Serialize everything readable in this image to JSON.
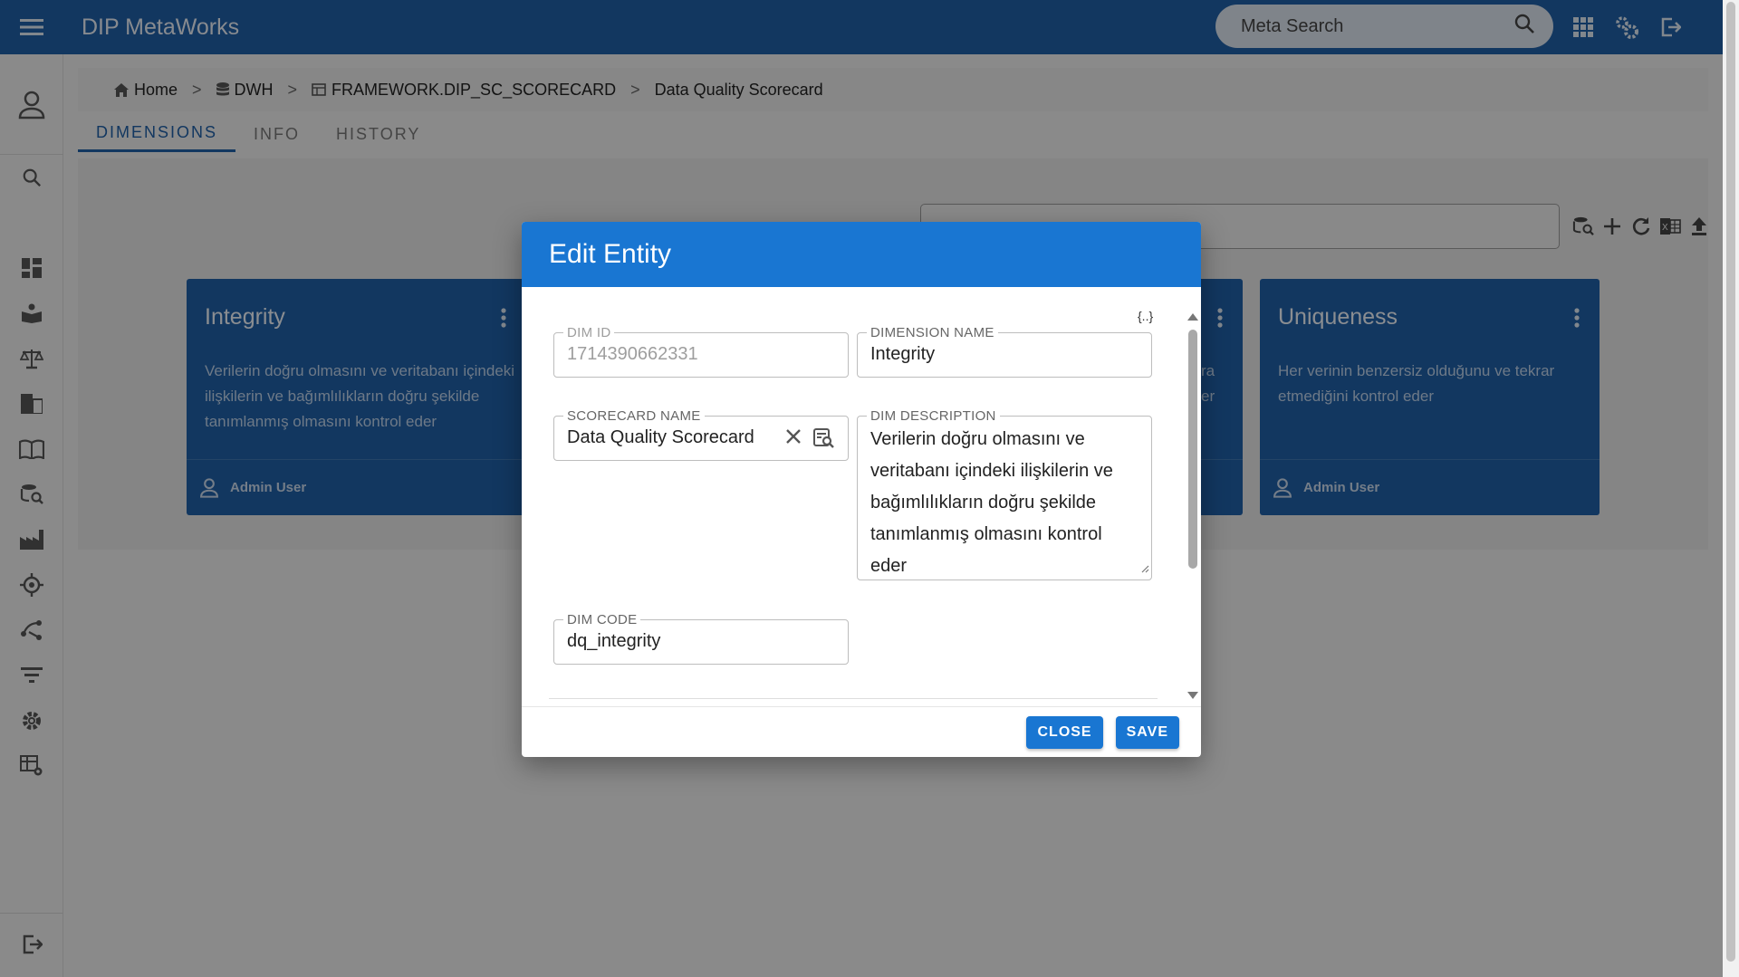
{
  "app": {
    "title": "DIP MetaWorks"
  },
  "header": {
    "search_placeholder": "Meta Search"
  },
  "breadcrumb": [
    {
      "label": "Home",
      "icon": "home-icon"
    },
    {
      "label": "DWH",
      "icon": "database-icon"
    },
    {
      "label": "FRAMEWORK.DIP_SC_SCORECARD",
      "icon": "table-icon"
    },
    {
      "label": "Data Quality Scorecard"
    }
  ],
  "breadcrumb_separator": ">",
  "tabs": [
    {
      "label": "DIMENSIONS",
      "active": true
    },
    {
      "label": "INFO"
    },
    {
      "label": "HISTORY"
    }
  ],
  "cards": [
    {
      "title": "Integrity",
      "description": "Verilerin doğru olmasını ve veritabanı içindeki ilişkilerin ve bağımlılıkların doğru şekilde tanımlanmış olmasını kontrol eder",
      "user": "Admin User"
    },
    {
      "title": "Uniqueness",
      "description": "Her verinin benzersiz olduğunu ve tekrar etmediğini kontrol eder",
      "user": "Admin User"
    }
  ],
  "partial_card": {
    "text_line1": "ra",
    "text_line2": "er"
  },
  "dialog": {
    "title": "Edit Entity",
    "json_toggle": "{..}",
    "fields": {
      "dim_id": {
        "label": "DIM ID",
        "value": "1714390662331"
      },
      "dimension_name": {
        "label": "DIMENSION NAME",
        "value": "Integrity"
      },
      "scorecard_name": {
        "label": "SCORECARD NAME",
        "value": "Data Quality Scorecard"
      },
      "dim_description": {
        "label": "DIM DESCRIPTION",
        "value": "Verilerin doğru olmasını ve veritabanı içindeki ilişkilerin ve bağımlılıkların doğru şekilde tanımlanmış olmasını kontrol eder"
      },
      "dim_code": {
        "label": "DIM CODE",
        "value": "dq_integrity"
      }
    },
    "buttons": {
      "close": "CLOSE",
      "save": "SAVE"
    }
  },
  "colors": {
    "primary": "#1f5fa6",
    "dialog_header": "#1976d2",
    "button": "#1976d2"
  }
}
